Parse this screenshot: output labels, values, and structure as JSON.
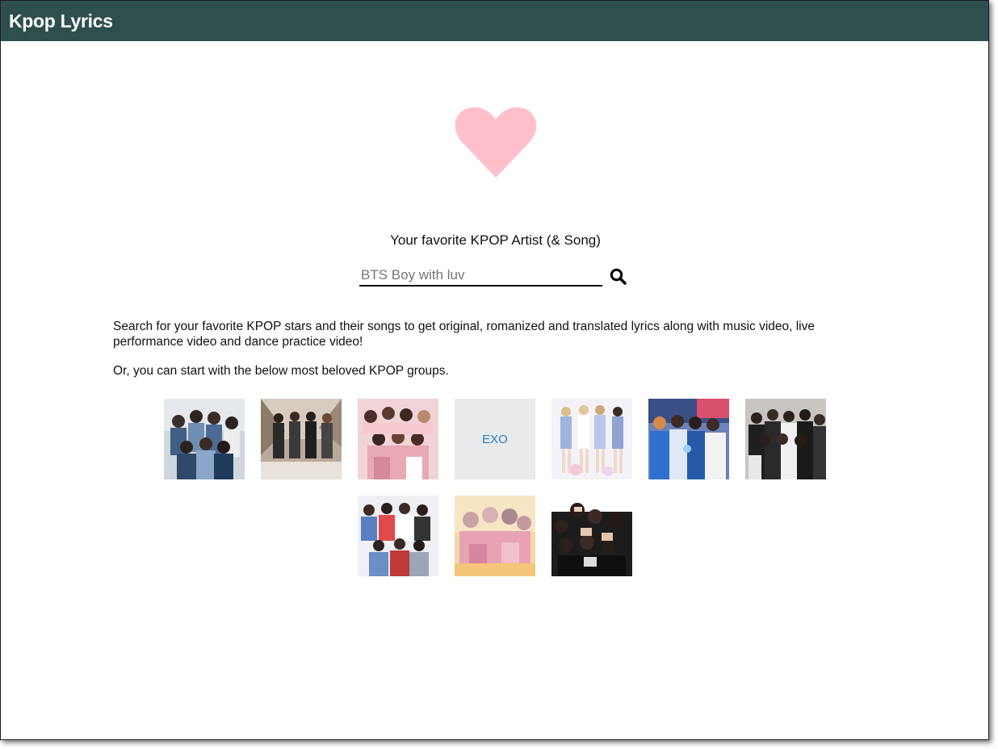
{
  "header": {
    "title": "Kpop Lyrics"
  },
  "hero": {
    "icon": "heart-icon",
    "color": "#ffc0cb"
  },
  "search": {
    "label": "Your favorite KPOP Artist (& Song)",
    "placeholder": "BTS Boy with luv",
    "button_icon": "search-icon"
  },
  "intro": {
    "line1": "Search for your favorite KPOP stars and their songs to get original, romanized and translated lyrics along with music video, live performance video and dance practice video!",
    "line2": "Or, you can start with the below most beloved KPOP groups."
  },
  "groups": [
    {
      "photo": "group-photo",
      "label": ""
    },
    {
      "photo": "group-photo",
      "label": ""
    },
    {
      "photo": "group-photo",
      "label": ""
    },
    {
      "photo": "text-tile",
      "label": "EXO"
    },
    {
      "photo": "group-photo",
      "label": ""
    },
    {
      "photo": "group-photo",
      "label": ""
    },
    {
      "photo": "group-photo",
      "label": ""
    },
    {
      "photo": "group-photo",
      "label": ""
    },
    {
      "photo": "group-photo",
      "label": ""
    },
    {
      "photo": "group-photo",
      "label": ""
    }
  ],
  "colors": {
    "header_bg": "#2f4f4f",
    "exo_text": "#1f7fc2"
  }
}
